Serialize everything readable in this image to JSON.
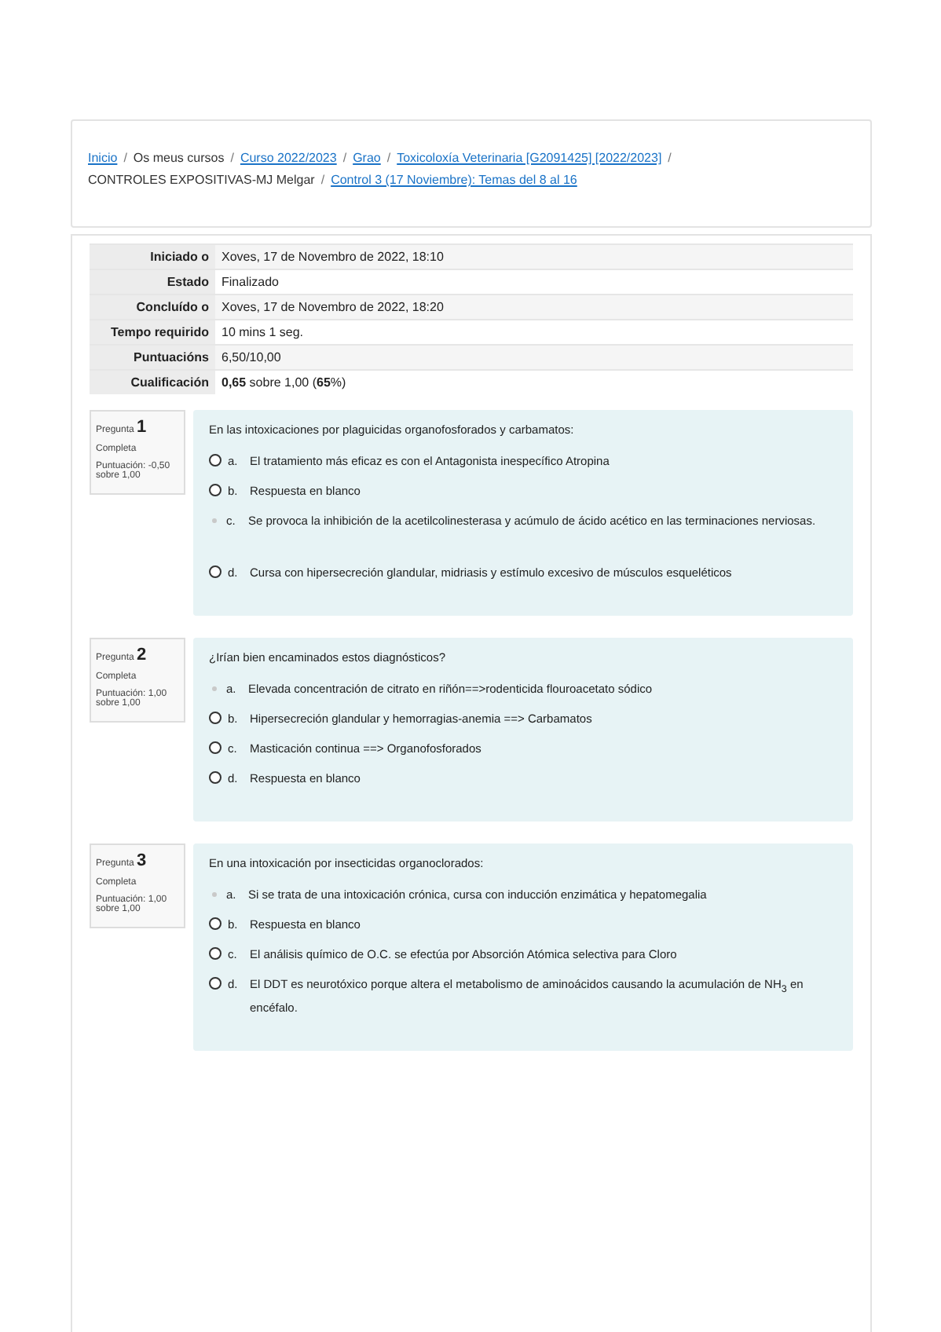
{
  "breadcrumb": [
    {
      "text": "Inicio",
      "link": true
    },
    {
      "separator": "/",
      "text": "Os meus cursos",
      "link": false
    },
    {
      "separator": "/",
      "text": "Curso 2022/2023",
      "link": true
    },
    {
      "separator": "/",
      "text": "Grao",
      "link": true
    },
    {
      "separator": "/",
      "text": "Toxicoloxía Veterinaria [G2091425] [2022/2023]",
      "link": true
    },
    {
      "separator": "/",
      "text": "CONTROLES EXPOSITIVAS-MJ Melgar",
      "link": false
    },
    {
      "separator": "/",
      "text": "Control 3 (17 Noviembre): Temas del 8 al 16",
      "link": true
    }
  ],
  "summary": [
    {
      "label": "Iniciado o",
      "value": "Xoves, 17 de Novembro de 2022, 18:10"
    },
    {
      "label": "Estado",
      "value": "Finalizado"
    },
    {
      "label": "Concluído o",
      "value": "Xoves, 17 de Novembro de 2022, 18:20"
    },
    {
      "label": "Tempo requirido",
      "value": "10 mins 1 seg."
    },
    {
      "label": "Puntuacións",
      "value": "6,50/10,00"
    },
    {
      "label": "Cualificación",
      "value": "**0,65** sobre 1,00 (**65**%)"
    }
  ],
  "questions": [
    {
      "label": "Pregunta",
      "number": "1",
      "status": "Completa",
      "score": "Puntuación: -0,50 sobre 1,00",
      "prompt": "En las intoxicaciones por plaguicidas organofosforados y carbamatos:",
      "options": [
        {
          "letter": "a.",
          "text": "El tratamiento más eficaz es con el Antagonista inespecífico Atropina",
          "selected": false
        },
        {
          "letter": "b.",
          "text": "Respuesta en blanco",
          "selected": false
        },
        {
          "letter": "c.",
          "text": "Se provoca la inhibición de la acetilcolinesterasa y acúmulo de ácido acético en las terminaciones nerviosas.",
          "selected": true
        },
        {
          "letter": "d.",
          "text": "Cursa con hipersecreción glandular, midriasis y estímulo excesivo de músculos esqueléticos",
          "selected": false
        }
      ]
    },
    {
      "label": "Pregunta",
      "number": "2",
      "status": "Completa",
      "score": "Puntuación: 1,00 sobre 1,00",
      "prompt": "¿Irían bien encaminados estos diagnósticos?",
      "options": [
        {
          "letter": "a.",
          "text": "Elevada concentración de citrato en riñón==>rodenticida flouroacetato sódico",
          "selected": true
        },
        {
          "letter": "b.",
          "text": "Hipersecreción glandular y hemorragias-anemia ==> Carbamatos",
          "selected": false
        },
        {
          "letter": "c.",
          "text": "Masticación continua ==> Organofosforados",
          "selected": false
        },
        {
          "letter": "d.",
          "text": "Respuesta en blanco",
          "selected": false
        }
      ]
    },
    {
      "label": "Pregunta",
      "number": "3",
      "status": "Completa",
      "score": "Puntuación: 1,00 sobre 1,00",
      "prompt": "En una intoxicación por insecticidas organoclorados:",
      "options": [
        {
          "letter": "a.",
          "text": "Si se trata de una intoxicación crónica, cursa con inducción enzimática y hepatomegalia",
          "selected": true
        },
        {
          "letter": "b.",
          "text": "Respuesta en blanco",
          "selected": false
        },
        {
          "letter": "c.",
          "text": "El análisis químico de O.C. se efectúa por Absorción Atómica selectiva para Cloro",
          "selected": false
        },
        {
          "letter": "d.",
          "text": "El DDT es neurotóxico porque altera el metabolismo de aminoácidos causando la acumulación de NH$_{3}$ en encéfalo.",
          "selected": false
        }
      ]
    }
  ]
}
